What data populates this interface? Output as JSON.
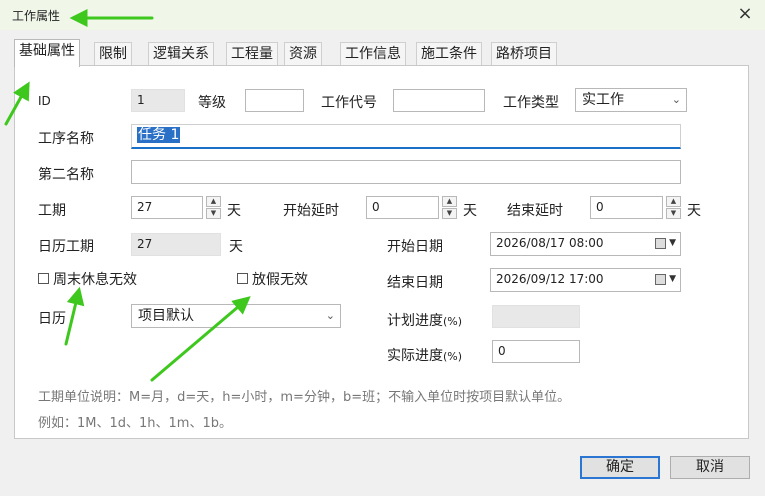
{
  "window": {
    "title": "工作属性",
    "close_glyph": "×"
  },
  "tabs": [
    "基础属性",
    "限制",
    "逻辑关系",
    "工程量",
    "资源",
    "工作信息",
    "施工条件",
    "路桥项目"
  ],
  "form": {
    "id_label": "ID",
    "id_value": "1",
    "grade_label": "等级",
    "grade_value": "",
    "code_label": "工作代号",
    "code_value": "",
    "type_label": "工作类型",
    "type_value": "实工作",
    "name_label": "工序名称",
    "name_value": "任务 1",
    "second_name_label": "第二名称",
    "second_name_value": "",
    "duration_label": "工期",
    "duration_value": "27",
    "duration_unit": "天",
    "start_delay_label": "开始延时",
    "start_delay_value": "0",
    "start_delay_unit": "天",
    "end_delay_label": "结束延时",
    "end_delay_value": "0",
    "end_delay_unit": "天",
    "calendar_duration_label": "日历工期",
    "calendar_duration_value": "27",
    "calendar_duration_unit": "天",
    "start_date_label": "开始日期",
    "start_date_value": "2026/08/17 08:00",
    "end_date_label": "结束日期",
    "end_date_value": "2026/09/12 17:00",
    "weekend_label": "周末休息无效",
    "weekend_checked": false,
    "holiday_label": "放假无效",
    "holiday_checked": false,
    "calendar_label": "日历",
    "calendar_value": "项目默认",
    "planned_progress_label": "计划进度",
    "planned_progress_suffix": "(%)",
    "planned_progress_value": "",
    "actual_progress_label": "实际进度",
    "actual_progress_suffix": "(%)",
    "actual_progress_value": "0"
  },
  "notes": {
    "line1": "工期单位说明：M=月，d=天，h=小时，m=分钟，b=班；不输入单位时按项目默认单位。",
    "line2": "例如：1M、1d、1h、1m、1b。"
  },
  "buttons": {
    "ok": "确定",
    "cancel": "取消"
  },
  "colors": {
    "title_bg": "#f0f7e9",
    "accent": "#2a76d2",
    "arrow": "#3ec81e"
  }
}
